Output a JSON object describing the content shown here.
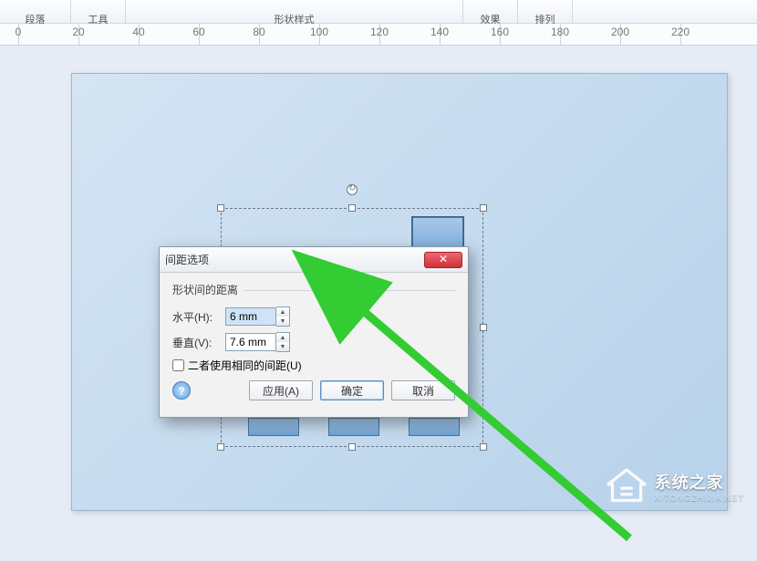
{
  "ribbon": {
    "paragraph": "段落",
    "tools": "工具",
    "shape_style": "形状样式",
    "effects": "效果",
    "arrange": "排列"
  },
  "ruler": {
    "ticks": [
      0,
      20,
      40,
      60,
      80,
      100,
      120,
      140,
      160,
      180,
      200,
      220
    ]
  },
  "dialog": {
    "title": "间距选项",
    "group": "形状间的距离",
    "h_label": "水平(H):",
    "h_value": "6 mm",
    "v_label": "垂直(V):",
    "v_value": "7.6 mm",
    "same_label": "二者使用相同的间距(U)",
    "apply": "应用(A)",
    "ok": "确定",
    "cancel": "取消",
    "close_glyph": "✕",
    "help_glyph": "?"
  },
  "watermark": {
    "line1": "系统之家",
    "line2": "XITONGZHIJIA.NET"
  }
}
